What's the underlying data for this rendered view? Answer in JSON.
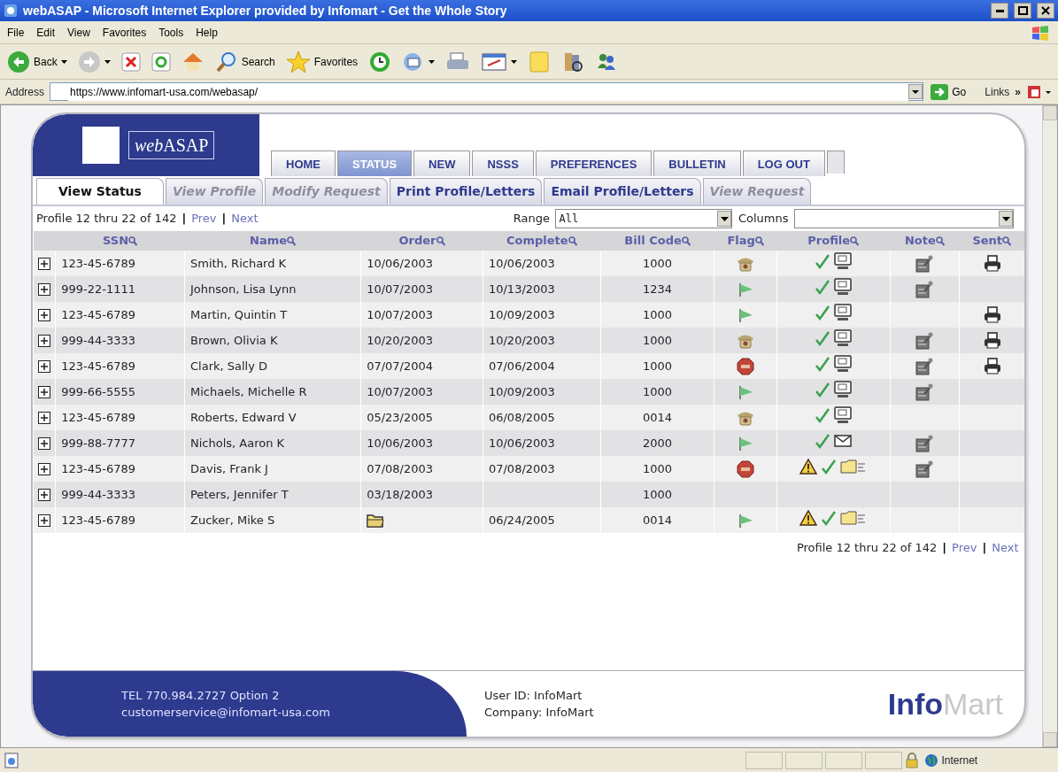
{
  "window": {
    "title": "webASAP - Microsoft Internet Explorer provided by Infomart - Get the Whole Story"
  },
  "menu": [
    "File",
    "Edit",
    "View",
    "Favorites",
    "Tools",
    "Help"
  ],
  "toolbar": {
    "back": "Back",
    "search": "Search",
    "favorites": "Favorites"
  },
  "address": {
    "label": "Address",
    "url": "https://www.infomart-usa.com/webasap/",
    "go": "Go",
    "links": "Links",
    "links_more": "»"
  },
  "app": {
    "logo": {
      "italic": "web",
      "plain": "ASAP"
    },
    "nav_tabs": [
      {
        "label": "HOME",
        "selected": false
      },
      {
        "label": "STATUS",
        "selected": true
      },
      {
        "label": "NEW",
        "selected": false
      },
      {
        "label": "NSSS",
        "selected": false
      },
      {
        "label": "PREFERENCES",
        "selected": false
      },
      {
        "label": "BULLETIN",
        "selected": false
      },
      {
        "label": "LOG OUT",
        "selected": false
      }
    ],
    "sub_tabs": [
      {
        "label": "View Status",
        "selected": true,
        "disabled": false
      },
      {
        "label": "View Profile",
        "selected": false,
        "disabled": true
      },
      {
        "label": "Modify Request",
        "selected": false,
        "disabled": true
      },
      {
        "label": "Print Profile/Letters",
        "selected": false,
        "disabled": false
      },
      {
        "label": "Email Profile/Letters",
        "selected": false,
        "disabled": false
      },
      {
        "label": "View Request",
        "selected": false,
        "disabled": true
      }
    ],
    "pager_top": {
      "summary": "Profile 12 thru 22 of 142",
      "sep": "|",
      "prev": "Prev",
      "next": "Next"
    },
    "range": {
      "label": "Range",
      "value": "All"
    },
    "columns_select": {
      "label": "Columns"
    },
    "table": {
      "columns": [
        "SSN",
        "Name",
        "Order",
        "Complete",
        "Bill Code",
        "Flag",
        "Profile",
        "Note",
        "Sent"
      ],
      "rows": [
        {
          "ssn": "123-45-6789",
          "name": "Smith, Richard K",
          "order": "10/06/2003",
          "complete": "10/06/2003",
          "bill_code": "1000",
          "flag": {
            "kind": "phone"
          },
          "profile": [
            {
              "kind": "check"
            },
            {
              "kind": "monitor"
            }
          ],
          "note": true,
          "sent": true
        },
        {
          "ssn": "999-22-1111",
          "name": "Johnson, Lisa Lynn",
          "order": "10/07/2003",
          "complete": "10/13/2003",
          "bill_code": "1234",
          "flag": {
            "kind": "flag"
          },
          "profile": [
            {
              "kind": "check"
            },
            {
              "kind": "monitor"
            }
          ],
          "note": true,
          "sent": false
        },
        {
          "ssn": "123-45-6789",
          "name": "Martin, Quintin T",
          "order": "10/07/2003",
          "complete": "10/09/2003",
          "bill_code": "1000",
          "flag": {
            "kind": "flag"
          },
          "profile": [
            {
              "kind": "check"
            },
            {
              "kind": "monitor"
            }
          ],
          "note": false,
          "sent": true
        },
        {
          "ssn": "999-44-3333",
          "name": "Brown, Olivia K",
          "order": "10/20/2003",
          "complete": "10/20/2003",
          "bill_code": "1000",
          "flag": {
            "kind": "phone"
          },
          "profile": [
            {
              "kind": "check"
            },
            {
              "kind": "monitor"
            }
          ],
          "note": true,
          "sent": true
        },
        {
          "ssn": "123-45-6789",
          "name": "Clark, Sally D",
          "order": "07/07/2004",
          "complete": "07/06/2004",
          "bill_code": "1000",
          "flag": {
            "kind": "stop"
          },
          "profile": [
            {
              "kind": "check"
            },
            {
              "kind": "monitor"
            }
          ],
          "note": true,
          "sent": true
        },
        {
          "ssn": "999-66-5555",
          "name": "Michaels, Michelle R",
          "order": "10/07/2003",
          "complete": "10/09/2003",
          "bill_code": "1000",
          "flag": {
            "kind": "flag"
          },
          "profile": [
            {
              "kind": "check"
            },
            {
              "kind": "monitor"
            }
          ],
          "note": true,
          "sent": false
        },
        {
          "ssn": "123-45-6789",
          "name": "Roberts, Edward V",
          "order": "05/23/2005",
          "complete": "06/08/2005",
          "bill_code": "0014",
          "flag": {
            "kind": "phone"
          },
          "profile": [
            {
              "kind": "check"
            },
            {
              "kind": "monitor"
            }
          ],
          "note": false,
          "sent": false
        },
        {
          "ssn": "999-88-7777",
          "name": "Nichols, Aaron K",
          "order": "10/06/2003",
          "complete": "10/06/2003",
          "bill_code": "2000",
          "flag": {
            "kind": "flag"
          },
          "profile": [
            {
              "kind": "check"
            },
            {
              "kind": "envelope"
            }
          ],
          "note": true,
          "sent": false
        },
        {
          "ssn": "123-45-6789",
          "name": "Davis, Frank J",
          "order": "07/08/2003",
          "complete": "07/08/2003",
          "bill_code": "1000",
          "flag": {
            "kind": "stop"
          },
          "profile": [
            {
              "kind": "warning"
            },
            {
              "kind": "check"
            },
            {
              "kind": "folder"
            }
          ],
          "note": true,
          "sent": false
        },
        {
          "ssn": "999-44-3333",
          "name": "Peters, Jennifer T",
          "order": "03/18/2003",
          "bill_code": "1000",
          "note": false,
          "sent": false
        },
        {
          "ssn": "123-45-6789",
          "name": "Zucker, Mike S",
          "order_icon": true,
          "complete": "06/24/2005",
          "bill_code": "0014",
          "flag": {
            "kind": "flag"
          },
          "profile": [
            {
              "kind": "warning"
            },
            {
              "kind": "check"
            },
            {
              "kind": "folder"
            }
          ],
          "note": false,
          "sent": false
        }
      ]
    },
    "pager_bottom": {
      "summary": "Profile 12 thru 22 of 142",
      "sep": "|",
      "prev": "Prev",
      "next": "Next"
    },
    "footer": {
      "phone": "TEL 770.984.2727 Option 2",
      "email": "customerservice@infomart-usa.com",
      "user_id": "User ID: InfoMart",
      "company": "Company: InfoMart",
      "brand_strong": "Info",
      "brand_light": "Mart"
    }
  },
  "status_bar": {
    "zone": "Internet"
  }
}
